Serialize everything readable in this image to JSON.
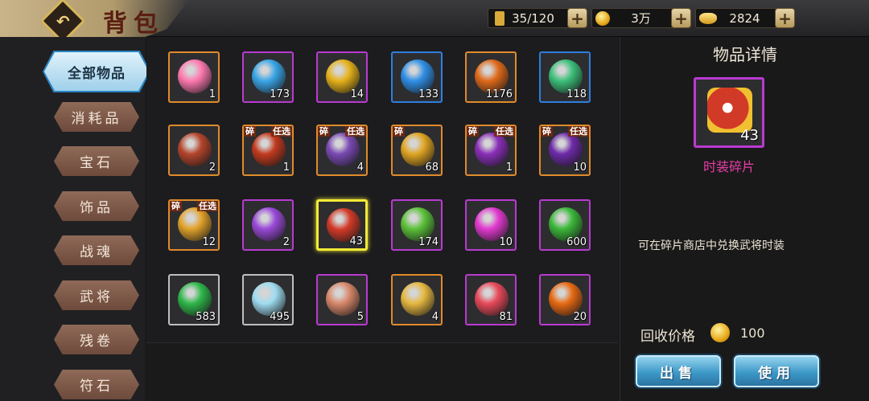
{
  "header": {
    "title": "背包",
    "back_icon": "back-arrow-icon",
    "resources": [
      {
        "name": "stamina",
        "icon": "flag-icon",
        "value": "35/120",
        "color": "#d9a93a"
      },
      {
        "name": "gold",
        "icon": "coin-icon",
        "value": "3万",
        "color": "#e6a716"
      },
      {
        "name": "ingot",
        "icon": "ingot-icon",
        "value": "2824",
        "color": "#f0c040"
      }
    ],
    "plus_label": "+"
  },
  "sidebar": {
    "items": [
      {
        "label": "全部物品",
        "active": true
      },
      {
        "label": "消耗品",
        "active": false
      },
      {
        "label": "宝石",
        "active": false
      },
      {
        "label": "饰品",
        "active": false
      },
      {
        "label": "战魂",
        "active": false
      },
      {
        "label": "武将",
        "active": false
      },
      {
        "label": "残卷",
        "active": false
      },
      {
        "label": "符石",
        "active": false
      }
    ]
  },
  "inventory": {
    "rows": [
      [
        {
          "icon": "rainbow-gem-icon",
          "qty": "1",
          "rarity": "orange",
          "color": "#ff7ab0"
        },
        {
          "icon": "blue-egg-icon",
          "qty": "173",
          "rarity": "purple",
          "color": "#3aa6e8"
        },
        {
          "icon": "gold-coin-icon",
          "qty": "14",
          "rarity": "purple",
          "color": "#e6b21a"
        },
        {
          "icon": "blue-flame-icon",
          "qty": "133",
          "rarity": "blue",
          "color": "#2f8fe6"
        },
        {
          "icon": "fire-stone-icon",
          "qty": "1176",
          "rarity": "orange",
          "color": "#e06a1a"
        },
        {
          "icon": "green-crystal-icon",
          "qty": "118",
          "rarity": "blue",
          "color": "#3cc07a"
        }
      ],
      [
        {
          "icon": "treasure-chest-icon",
          "qty": "2",
          "rarity": "orange",
          "color": "#b5452b"
        },
        {
          "icon": "red-armor-icon",
          "qty": "1",
          "rarity": "orange",
          "color": "#c23a1e",
          "tag_l": "碎",
          "tag_r": "任选"
        },
        {
          "icon": "purple-chest-icon",
          "qty": "4",
          "rarity": "orange",
          "color": "#7a4ab3",
          "tag_l": "碎",
          "tag_r": "任选"
        },
        {
          "icon": "gold-armor-icon",
          "qty": "68",
          "rarity": "orange",
          "color": "#e0a522",
          "tag_l": "碎",
          "tag_r": ""
        },
        {
          "icon": "purple-armor-icon",
          "qty": "1",
          "rarity": "orange",
          "color": "#8a2fb8",
          "tag_l": "碎",
          "tag_r": "任选"
        },
        {
          "icon": "purple-armor-icon",
          "qty": "10",
          "rarity": "orange",
          "color": "#6e2aa8",
          "tag_l": "碎",
          "tag_r": "任选"
        }
      ],
      [
        {
          "icon": "gold-chest-icon",
          "qty": "12",
          "rarity": "orange",
          "color": "#e2a32a",
          "tag_l": "碎",
          "tag_r": "任选"
        },
        {
          "icon": "mystery-gems-icon",
          "qty": "2",
          "rarity": "purple",
          "color": "#9a4ad8"
        },
        {
          "icon": "costume-fragment-icon",
          "qty": "43",
          "rarity": "selected",
          "color": "#d23a28"
        },
        {
          "icon": "green-leaf-icon",
          "qty": "174",
          "rarity": "purple",
          "color": "#5cc23a"
        },
        {
          "icon": "pink-orb-icon",
          "qty": "10",
          "rarity": "purple",
          "color": "#e23ad0"
        },
        {
          "icon": "paw-print-icon",
          "qty": "600",
          "rarity": "purple",
          "color": "#3cb83a"
        }
      ],
      [
        {
          "icon": "emerald-icon",
          "qty": "583",
          "rarity": "gray",
          "color": "#2fb84a"
        },
        {
          "icon": "ice-crystal-icon",
          "qty": "495",
          "rarity": "gray",
          "color": "#9fdcf0"
        },
        {
          "icon": "scroll-icon",
          "qty": "5",
          "rarity": "purple",
          "color": "#d8886a"
        },
        {
          "icon": "gold-badge-icon",
          "qty": "4",
          "rarity": "orange",
          "color": "#e6b840"
        },
        {
          "icon": "rank-card-icon",
          "qty": "81",
          "rarity": "purple",
          "color": "#e84a5a"
        },
        {
          "icon": "pumpkin-icon",
          "qty": "20",
          "rarity": "purple",
          "color": "#e86a12"
        }
      ]
    ]
  },
  "detail": {
    "title": "物品详情",
    "item_icon": "costume-fragment-icon",
    "item_qty": "43",
    "item_name": "时装碎片",
    "description": "可在碎片商店中兑换武将时装",
    "price_label": "回收价格",
    "price_icon": "coin-icon",
    "price_value": "100",
    "sell_label": "出售",
    "use_label": "使用"
  }
}
